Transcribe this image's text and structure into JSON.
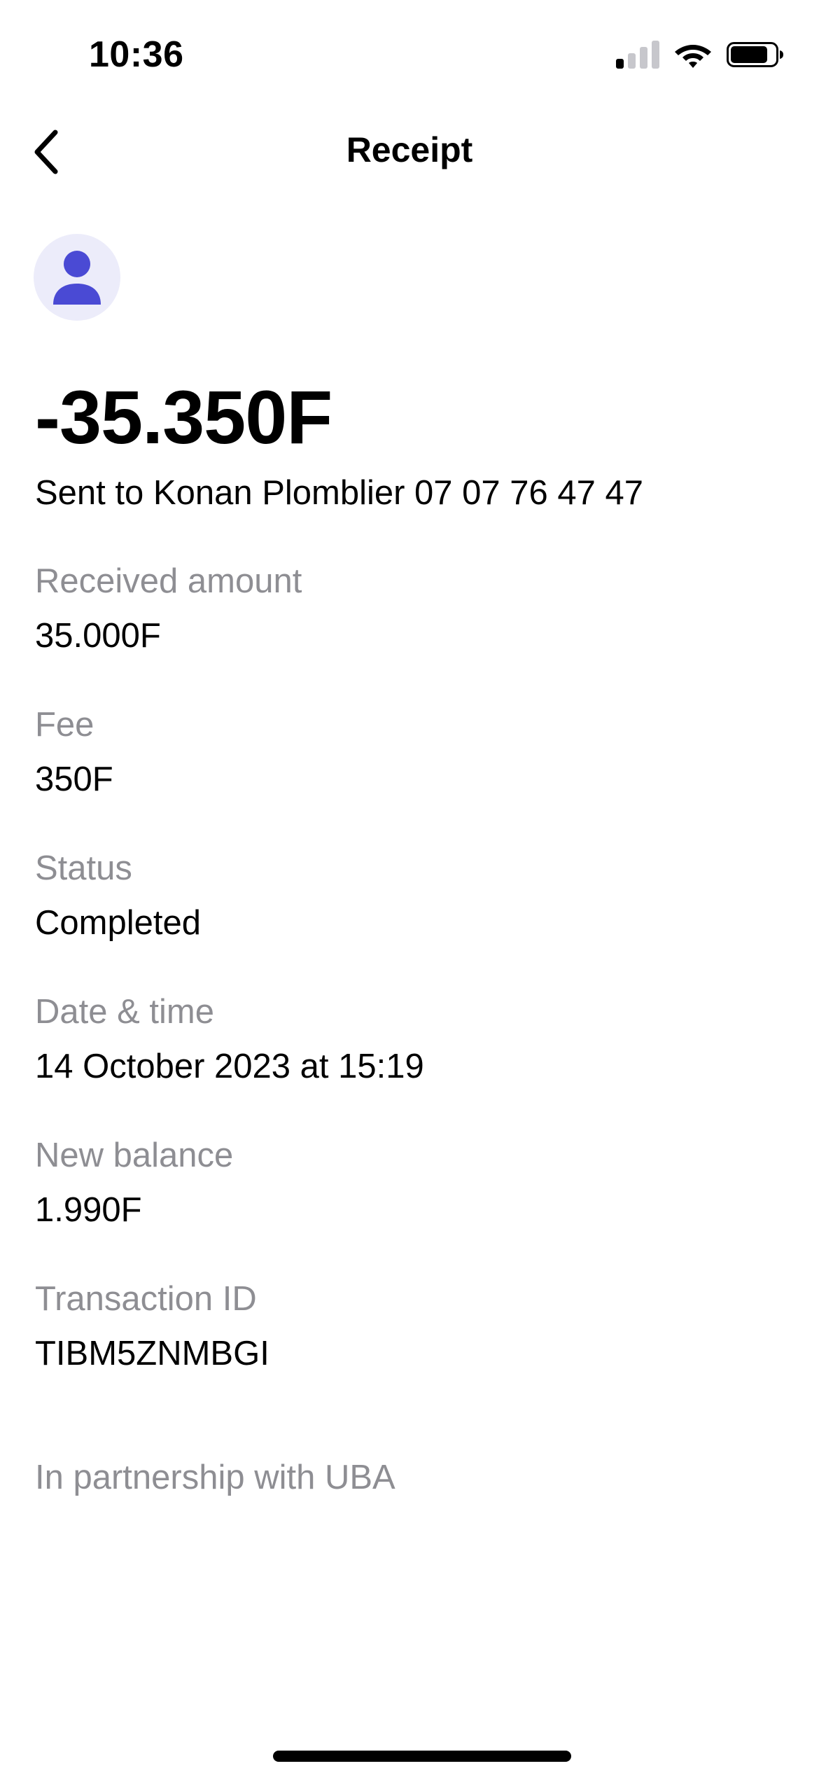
{
  "status_bar": {
    "time": "10:36",
    "icons": [
      "signal-icon",
      "wifi-icon",
      "battery-icon"
    ]
  },
  "nav": {
    "title": "Receipt",
    "back_icon": "chevron-left-icon"
  },
  "avatar": {
    "icon": "person-icon",
    "accent_color": "#4a4ad4",
    "background_color": "#ececfa"
  },
  "transaction": {
    "amount": "-35.350F",
    "recipient_line": "Sent to Konan Plomblier 07 07 76 47 47"
  },
  "details": [
    {
      "label": "Received amount",
      "value": "35.000F"
    },
    {
      "label": "Fee",
      "value": "350F"
    },
    {
      "label": "Status",
      "value": "Completed"
    },
    {
      "label": "Date & time",
      "value": "14 October 2023 at 15:19"
    },
    {
      "label": "New balance",
      "value": "1.990F"
    },
    {
      "label": "Transaction ID",
      "value": "TIBM5ZNMBGI"
    }
  ],
  "footer": {
    "partnership": "In partnership with UBA"
  }
}
